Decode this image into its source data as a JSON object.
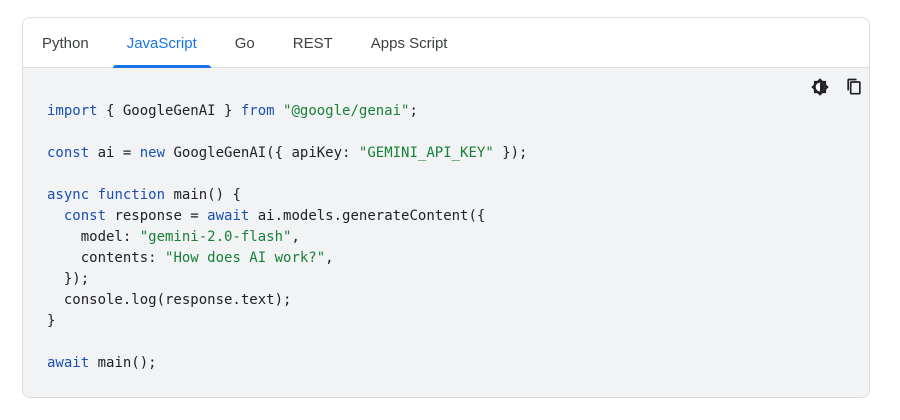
{
  "tabs": [
    {
      "label": "Python",
      "active": false
    },
    {
      "label": "JavaScript",
      "active": true
    },
    {
      "label": "Go",
      "active": false
    },
    {
      "label": "REST",
      "active": false
    },
    {
      "label": "Apps Script",
      "active": false
    }
  ],
  "toolbar": {
    "theme_icon": "brightness-contrast-icon",
    "copy_icon": "copy-icon"
  },
  "colors": {
    "accent": "#1a73e8",
    "keyword": "#1a4fb4",
    "string": "#188038",
    "code_bg": "#f1f3f4"
  },
  "code": {
    "lines": [
      [
        {
          "t": "import",
          "k": "kw"
        },
        {
          "t": " { GoogleGenAI } "
        },
        {
          "t": "from",
          "k": "kw"
        },
        {
          "t": " "
        },
        {
          "t": "\"@google/genai\"",
          "k": "str"
        },
        {
          "t": ";"
        }
      ],
      [],
      [
        {
          "t": "const",
          "k": "kw"
        },
        {
          "t": " ai = "
        },
        {
          "t": "new",
          "k": "kw"
        },
        {
          "t": " GoogleGenAI({ apiKey: "
        },
        {
          "t": "\"GEMINI_API_KEY\"",
          "k": "str"
        },
        {
          "t": " });"
        }
      ],
      [],
      [
        {
          "t": "async",
          "k": "kw"
        },
        {
          "t": " "
        },
        {
          "t": "function",
          "k": "kw"
        },
        {
          "t": " main() {"
        }
      ],
      [
        {
          "t": "  "
        },
        {
          "t": "const",
          "k": "kw"
        },
        {
          "t": " response = "
        },
        {
          "t": "await",
          "k": "kw"
        },
        {
          "t": " ai.models.generateContent({"
        }
      ],
      [
        {
          "t": "    model: "
        },
        {
          "t": "\"gemini-2.0-flash\"",
          "k": "str"
        },
        {
          "t": ","
        }
      ],
      [
        {
          "t": "    contents: "
        },
        {
          "t": "\"How does AI work?\"",
          "k": "str"
        },
        {
          "t": ","
        }
      ],
      [
        {
          "t": "  });"
        }
      ],
      [
        {
          "t": "  console.log(response.text);"
        }
      ],
      [
        {
          "t": "}"
        }
      ],
      [],
      [
        {
          "t": "await",
          "k": "kw"
        },
        {
          "t": " main();"
        }
      ]
    ]
  }
}
